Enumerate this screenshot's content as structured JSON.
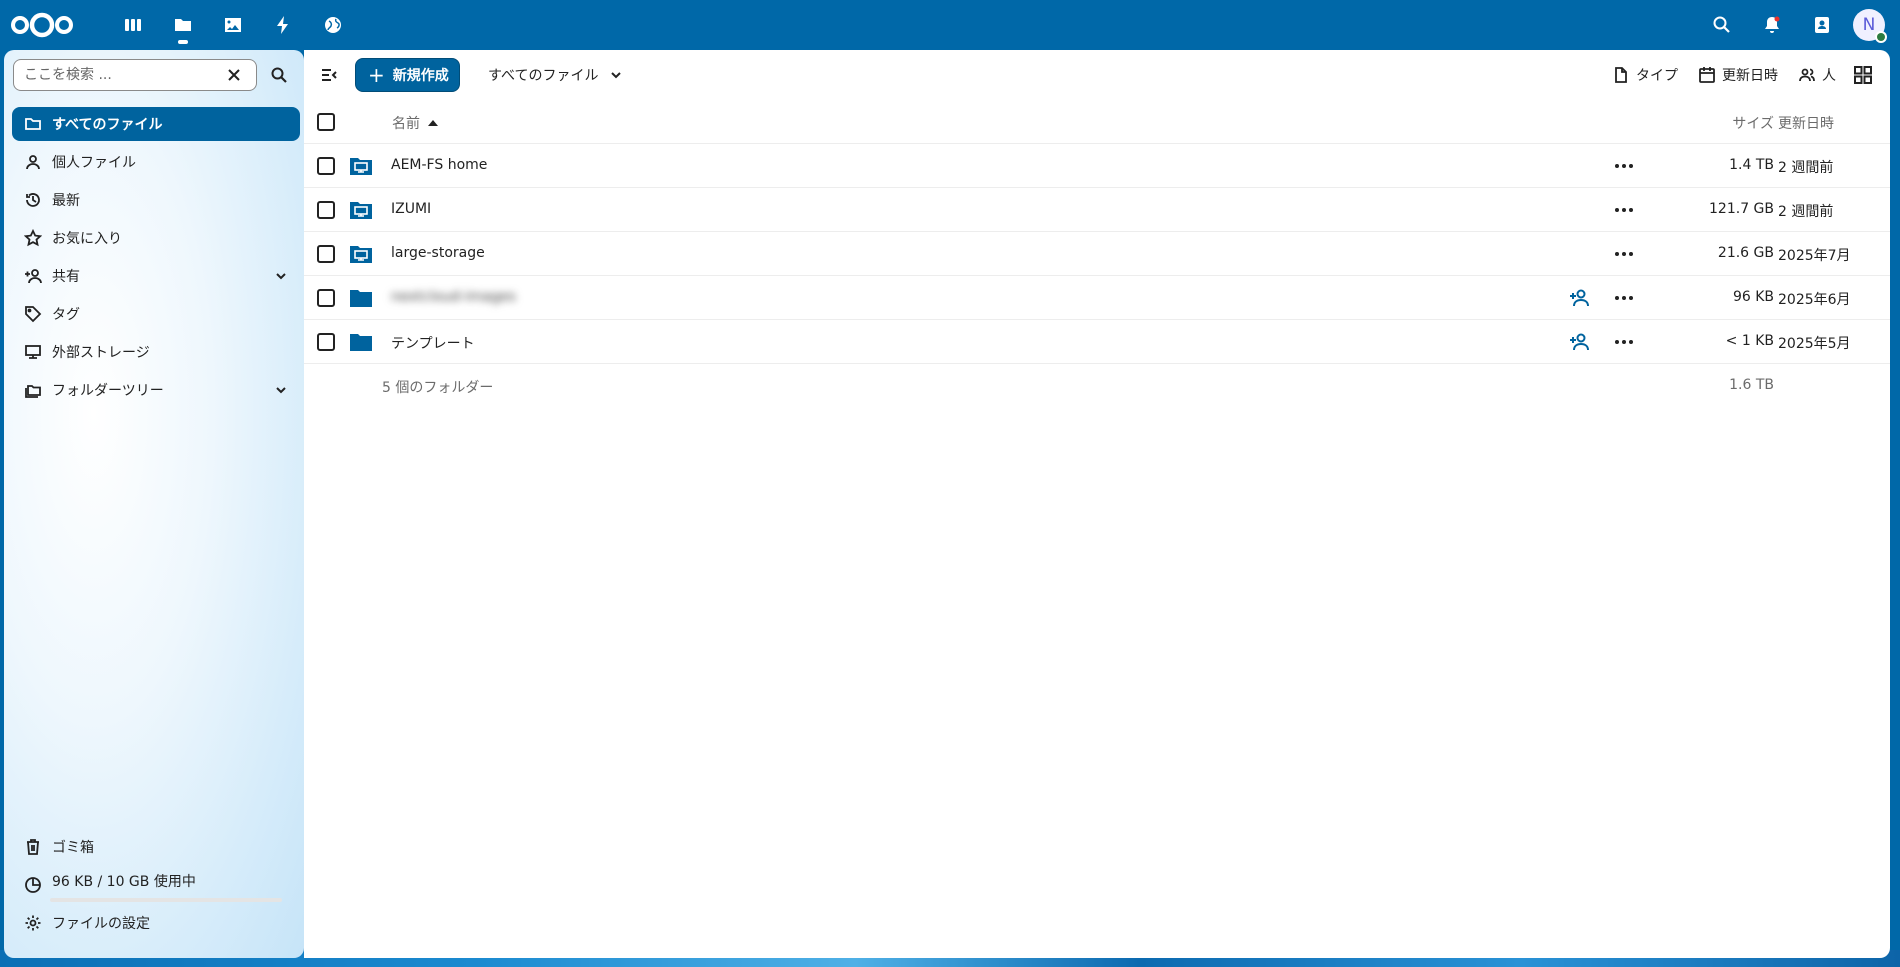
{
  "header": {
    "apps": [
      {
        "name": "dashboard",
        "icon": "dashboard-icon"
      },
      {
        "name": "files",
        "icon": "folder-icon",
        "active": true
      },
      {
        "name": "photos",
        "icon": "image-icon"
      },
      {
        "name": "activity",
        "icon": "lightning-icon"
      },
      {
        "name": "circles",
        "icon": "globe-icon"
      }
    ],
    "avatar_initial": "N"
  },
  "sidebar": {
    "search_placeholder": "ここを検索 ...",
    "items": [
      {
        "label": "すべてのファイル",
        "icon": "folder-icon",
        "active": true
      },
      {
        "label": "個人ファイル",
        "icon": "user-icon"
      },
      {
        "label": "最新",
        "icon": "history-icon"
      },
      {
        "label": "お気に入り",
        "icon": "star-icon"
      },
      {
        "label": "共有",
        "icon": "share-icon",
        "expandable": true
      },
      {
        "label": "タグ",
        "icon": "tag-icon"
      },
      {
        "label": "外部ストレージ",
        "icon": "monitor-icon"
      },
      {
        "label": "フォルダーツリー",
        "icon": "folder-tree-icon",
        "expandable": true
      }
    ],
    "trash_label": "ゴミ箱",
    "quota_label": "96 KB / 10 GB 使用中",
    "quota_fraction": 0.0,
    "settings_label": "ファイルの設定"
  },
  "toolbar": {
    "new_label": "新規作成",
    "breadcrumb": "すべてのファイル",
    "filter_type": "タイプ",
    "filter_modified": "更新日時",
    "filter_people": "人"
  },
  "table": {
    "col_name": "名前",
    "col_size": "サイズ",
    "col_modified": "更新日時",
    "rows": [
      {
        "name": "AEM-FS home",
        "type": "external",
        "size": "1.4 TB",
        "modified": "2 週間前",
        "shareable": false
      },
      {
        "name": "IZUMI",
        "type": "external",
        "size": "121.7 GB",
        "modified": "2 週間前",
        "shareable": false
      },
      {
        "name": "large-storage",
        "type": "external",
        "size": "21.6 GB",
        "modified": "2025年7月",
        "shareable": false
      },
      {
        "name": "nextcloud-images",
        "type": "folder",
        "size": "96 KB",
        "modified": "2025年6月",
        "shareable": true,
        "blurred": true
      },
      {
        "name": "テンプレート",
        "type": "folder",
        "size": "< 1 KB",
        "modified": "2025年5月",
        "shareable": true
      }
    ],
    "summary_count": "5 個のフォルダー",
    "summary_total": "1.6 TB"
  },
  "colors": {
    "primary": "#00639e",
    "header_bg": "#0068a8"
  }
}
